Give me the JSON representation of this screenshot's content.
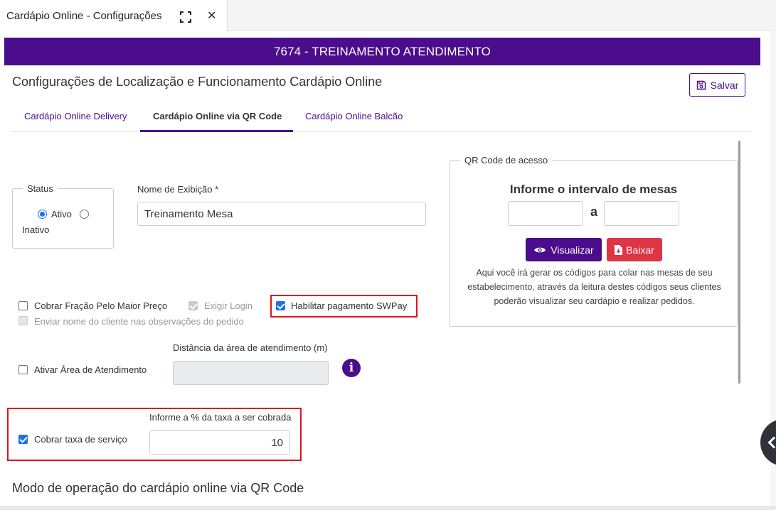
{
  "window": {
    "tab_title": "Cardápio Online - Configurações",
    "expand_icon": "expand-icon",
    "close_icon": "close-icon",
    "close_glyph": "✕"
  },
  "banner": {
    "text": "7674 - TREINAMENTO ATENDIMENTO",
    "color": "#4b0d8b"
  },
  "header": {
    "title": "Configurações de Localização e Funcionamento Cardápio Online",
    "save_label": "Salvar"
  },
  "tabs": [
    {
      "label": "Cardápio Online Delivery",
      "active": false
    },
    {
      "label": "Cardápio Online via QR Code",
      "active": true
    },
    {
      "label": "Cardápio Online Balcão",
      "active": false
    }
  ],
  "status": {
    "legend": "Status",
    "options": [
      {
        "label": "Ativo",
        "checked": true
      },
      {
        "label": "Inativo",
        "checked": false
      }
    ]
  },
  "display_name": {
    "label": "Nome de Exibição *",
    "value": "Treinamento Mesa"
  },
  "options": {
    "cobrar_fracao": {
      "label": "Cobrar Fração Pelo Maior Preço",
      "checked": false
    },
    "exigir_login": {
      "label": "Exigir Login",
      "checked": true,
      "disabled": true
    },
    "habilitar_swpay": {
      "label": "Habilitar pagamento SWPay",
      "checked": true
    },
    "enviar_nome": {
      "label": "Enviar nome do cliente nas observações do pedido",
      "checked": false,
      "disabled": true
    }
  },
  "area": {
    "checkbox_label": "Ativar Área de Atendimento",
    "checked": false,
    "distance_label": "Distância da área de atendimento (m)",
    "distance_value": ""
  },
  "service_fee": {
    "checkbox_label": "Cobrar taxa de serviço",
    "checked": true,
    "input_label": "Informe a % da taxa a ser cobrada",
    "value": "10"
  },
  "qr": {
    "legend": "QR Code de acesso",
    "heading": "Informe o intervalo de mesas",
    "separator": "a",
    "from_value": "",
    "to_value": "",
    "view_label": "Visualizar",
    "download_label": "Baixar",
    "description": "Aqui você irá gerar os códigos para colar nas mesas de seu estabelecimento, através da leitura destes códigos seus clientes poderão visualizar seu cardápio e realizar pedidos."
  },
  "section": {
    "title": "Modo de operação do cardápio online via QR Code"
  },
  "colors": {
    "primary": "#4b0d8b",
    "danger": "#dc3545",
    "highlight": "#e0141e",
    "check": "#1a73e8"
  }
}
